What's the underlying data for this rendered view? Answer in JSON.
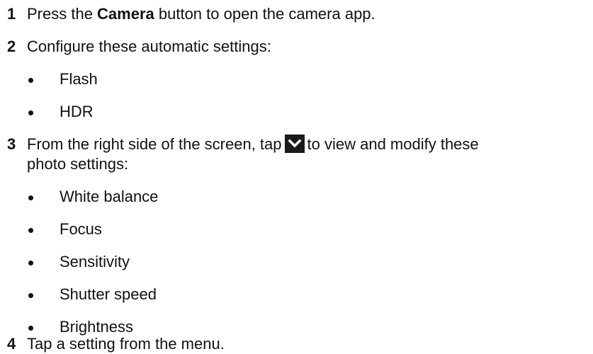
{
  "steps": [
    {
      "number": "1",
      "pre": "Press the ",
      "bold": "Camera",
      "post": " button to open the camera app."
    },
    {
      "number": "2",
      "text": "Configure these automatic settings:"
    },
    {
      "number": "3",
      "pre": "From the right side of the screen, tap",
      "post": "to view and modify these",
      "line2": "photo settings:",
      "icon": "chevron-down-icon"
    },
    {
      "number": "4",
      "text": "Tap a setting from the menu."
    }
  ],
  "step2_bullets": [
    "Flash",
    "HDR"
  ],
  "step3_bullets": [
    "White balance",
    "Focus",
    "Sensitivity",
    "Shutter speed",
    "Brightness"
  ]
}
